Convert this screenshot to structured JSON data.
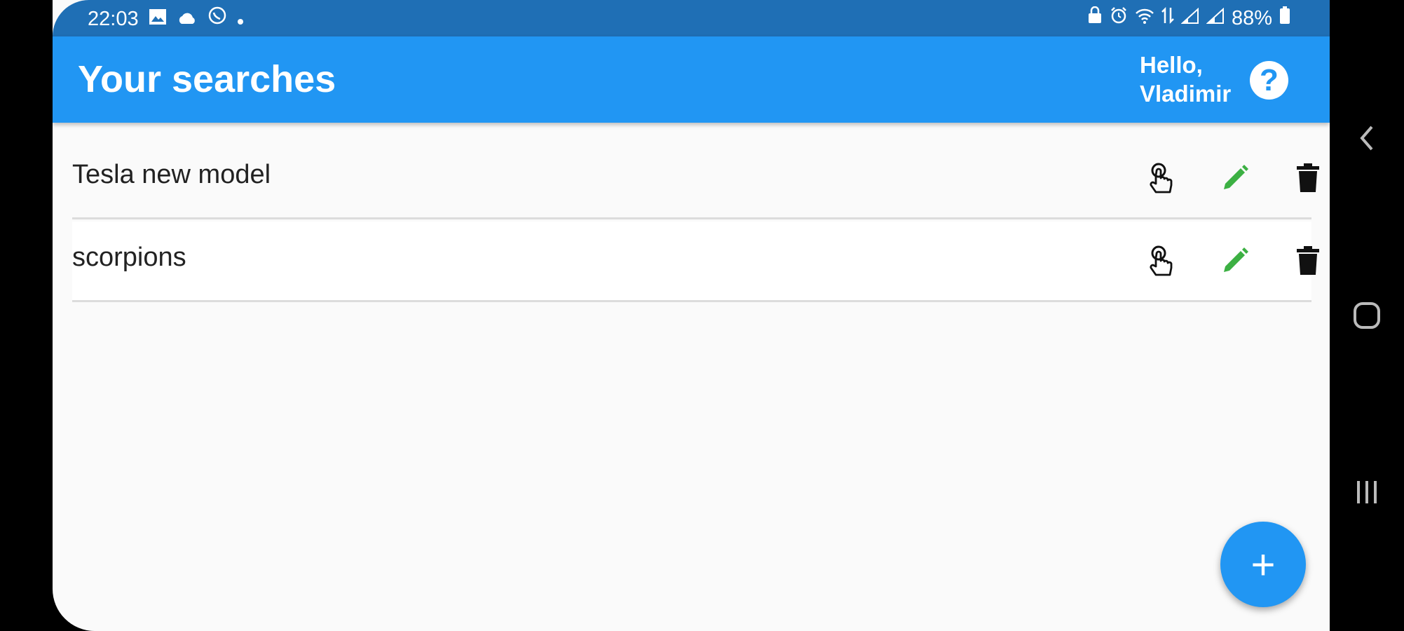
{
  "status_bar": {
    "time": "22:03",
    "battery": "88%",
    "left_icons": [
      "gallery-icon",
      "cloud-icon",
      "viber-icon",
      "dot-icon"
    ],
    "right_icons": [
      "lock-icon",
      "alarm-icon",
      "wifi-icon",
      "data-icon",
      "signal-icon",
      "signal-icon",
      "battery-icon"
    ]
  },
  "app_bar": {
    "title": "Your searches",
    "greeting_line1": "Hello,",
    "greeting_line2": "Vladimir",
    "help_label": "?"
  },
  "searches": [
    {
      "label": "Tesla new model"
    },
    {
      "label": "scorpions"
    }
  ],
  "fab_label": "+",
  "colors": {
    "primary": "#2196f3",
    "status_bar": "#1f6fb5",
    "edit_icon": "#3cb043",
    "background": "#fafafa"
  }
}
